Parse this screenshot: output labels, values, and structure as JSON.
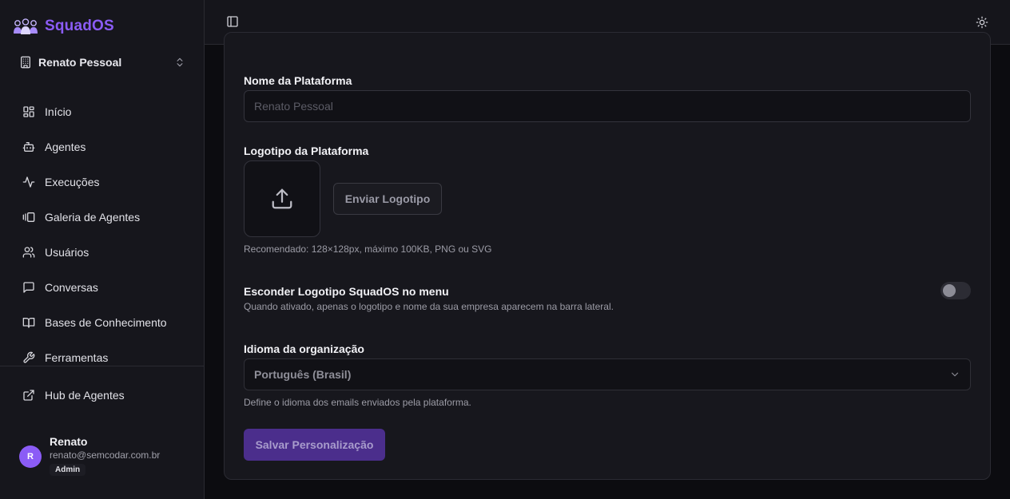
{
  "brand": {
    "name": "SquadOS",
    "accent": "#8b5cf6"
  },
  "org": {
    "name": "Renato Pessoal"
  },
  "nav": {
    "items": [
      {
        "label": "Início",
        "icon": "dashboard-icon"
      },
      {
        "label": "Agentes",
        "icon": "bot-icon"
      },
      {
        "label": "Execuções",
        "icon": "activity-icon"
      },
      {
        "label": "Galeria de Agentes",
        "icon": "gallery-icon"
      },
      {
        "label": "Usuários",
        "icon": "users-icon"
      },
      {
        "label": "Conversas",
        "icon": "message-icon"
      },
      {
        "label": "Bases de Conhecimento",
        "icon": "book-icon"
      },
      {
        "label": "Ferramentas",
        "icon": "wrench-icon"
      }
    ],
    "hub": {
      "label": "Hub de Agentes",
      "icon": "external-link-icon"
    }
  },
  "user": {
    "initial": "R",
    "name": "Renato",
    "email": "renato@semcodar.com.br",
    "role": "Admin"
  },
  "form": {
    "platform_name": {
      "label": "Nome da Plataforma",
      "placeholder": "Renato Pessoal",
      "value": ""
    },
    "logo": {
      "label": "Logotipo da Plataforma",
      "upload_label": "Enviar Logotipo",
      "hint": "Recomendado: 128×128px, máximo 100KB, PNG ou SVG"
    },
    "hide_logo": {
      "label": "Esconder Logotipo SquadOS no menu",
      "description": "Quando ativado, apenas o logotipo e nome da sua empresa aparecem na barra lateral.",
      "enabled": false
    },
    "language": {
      "label": "Idioma da organização",
      "value": "Português (Brasil)",
      "hint": "Define o idioma dos emails enviados pela plataforma."
    },
    "save_label": "Salvar Personalização"
  }
}
